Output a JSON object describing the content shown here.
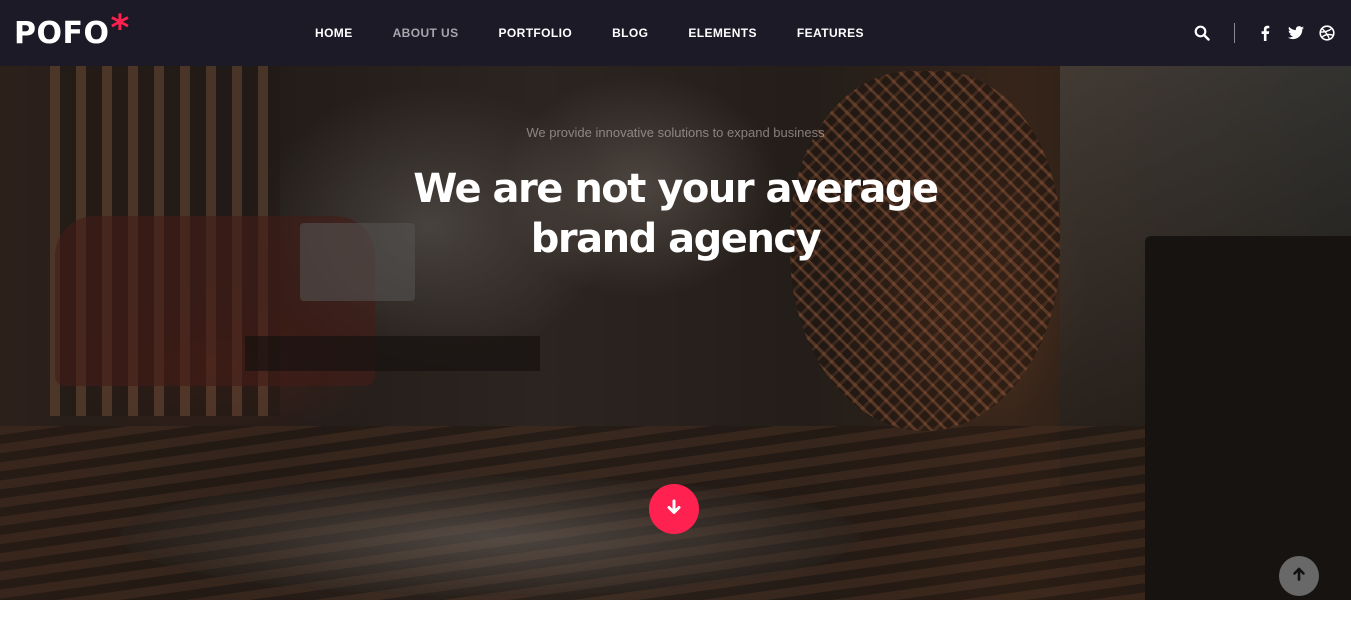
{
  "header": {
    "logo_text": "POFO",
    "logo_mark": "*",
    "nav": [
      {
        "label": "HOME",
        "active": false
      },
      {
        "label": "ABOUT US",
        "active": true
      },
      {
        "label": "PORTFOLIO",
        "active": false
      },
      {
        "label": "BLOG",
        "active": false
      },
      {
        "label": "ELEMENTS",
        "active": false
      },
      {
        "label": "FEATURES",
        "active": false
      }
    ],
    "icons": [
      "search-icon",
      "facebook-icon",
      "twitter-icon",
      "dribbble-icon"
    ]
  },
  "hero": {
    "subtitle": "We provide innovative solutions to expand business",
    "headline_line1": "We are not your average",
    "headline_line2": "brand agency",
    "scroll_down_icon": "arrow-down-icon",
    "back_to_top_icon": "arrow-up-icon"
  },
  "colors": {
    "header_bg": "#1c1a26",
    "accent": "#ff214f",
    "nav_text": "#ffffff",
    "nav_active_text": "#a6a6ad"
  }
}
